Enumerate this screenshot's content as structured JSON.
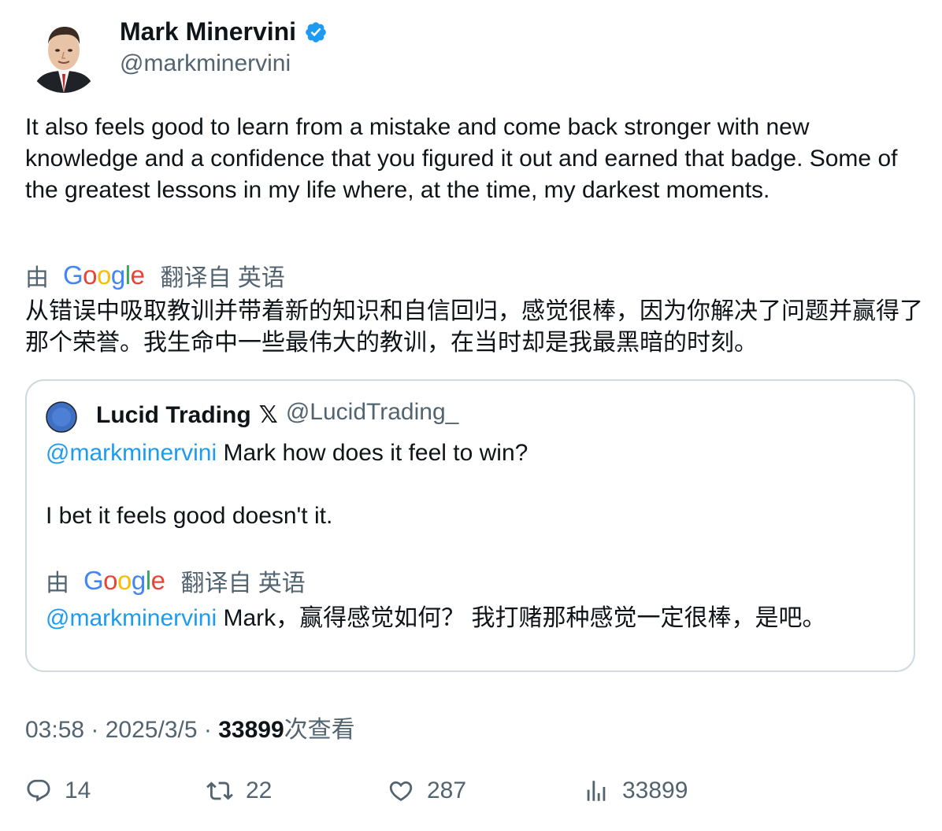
{
  "author": {
    "name": "Mark Minervini",
    "handle": "@markminervini",
    "verified_color": "#1d9bf0"
  },
  "tweet": {
    "text": "It also feels good to learn from a mistake and come back stronger with new knowledge and a confidence that you figured it out and earned that badge. Some of the greatest lessons in my life where, at the time, my darkest moments.",
    "translate": {
      "by": "由",
      "logo": "Google",
      "from_label": "翻译自 英语"
    },
    "translated_text": "从错误中吸取教训并带着新的知识和自信回归，感觉很棒，因为你解决了问题并赢得了那个荣誉。我生命中一些最伟大的教训，在当时却是我最黑暗的时刻。"
  },
  "quote": {
    "name": "Lucid Trading",
    "badge": "𝕏",
    "handle": "@LucidTrading_",
    "mention": "@markminervini",
    "line1_text": " Mark how does it feel to win?",
    "line2_text": "I bet it feels good doesn't it.",
    "translate": {
      "by": "由",
      "logo": "Google",
      "from_label": "翻译自 英语"
    },
    "translated_mention": "@markminervini",
    "translated_text": " Mark，赢得感觉如何？ 我打赌那种感觉一定很棒，是吧。"
  },
  "meta": {
    "time": "03:58",
    "sep1": " · ",
    "date": "2025/3/5",
    "sep2": " · ",
    "views_count": "33899",
    "views_label": "次查看"
  },
  "actions": {
    "replies": "14",
    "retweets": "22",
    "likes": "287",
    "views": "33899"
  },
  "colors": {
    "accent": "#1d9bf0",
    "secondary_text": "#536471",
    "border": "#cfd9de"
  }
}
